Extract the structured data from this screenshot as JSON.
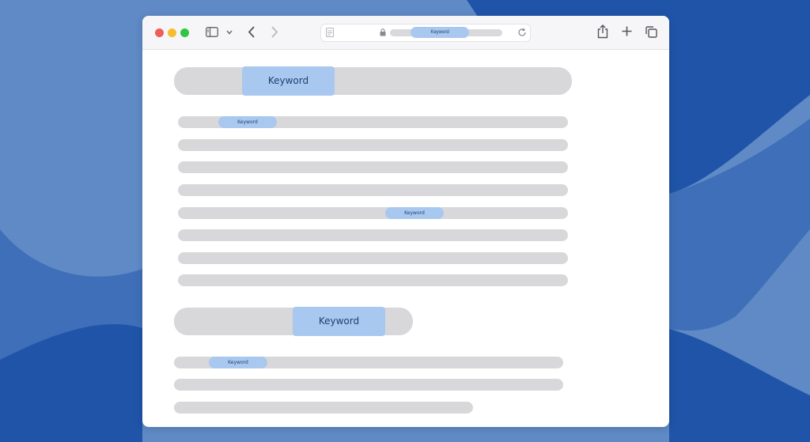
{
  "colors": {
    "background": "#5a86c3",
    "keyword_highlight": "#a9c8ef",
    "placeholder_bar": "#d8d8da",
    "close": "#ee5e58",
    "minimize": "#f5bd2f",
    "zoom": "#2fc641"
  },
  "browser": {
    "address_keyword": "Keyword",
    "icons": [
      "sidebar-icon",
      "chevron-down-icon",
      "back-icon",
      "forward-icon",
      "reader-icon",
      "lock-icon",
      "reload-icon",
      "share-icon",
      "new-tab-icon",
      "tabs-overview-icon"
    ]
  },
  "page": {
    "heading_1_keyword": "Keyword",
    "line_1_keyword": "Keyword",
    "line_5_keyword": "Keyword",
    "heading_2_keyword": "Keyword",
    "line_9_keyword": "Keyword"
  }
}
